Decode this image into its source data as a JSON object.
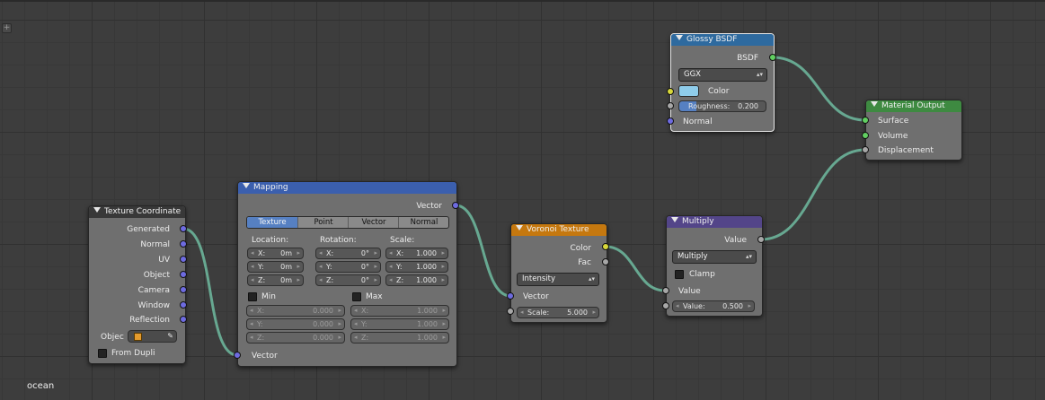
{
  "editor_label": "ocean",
  "corner_icon": "+",
  "colors": {
    "header_coord": "#383838",
    "header_mapping": "#3b5fae",
    "header_voronoi": "#c5780f",
    "header_multiply": "#534589",
    "header_glossy": "#2e6a9f",
    "header_output": "#3e8a41",
    "link": "#67a891"
  },
  "texture_coordinate": {
    "title": "Texture Coordinate",
    "outputs": [
      "Generated",
      "Normal",
      "UV",
      "Object",
      "Camera",
      "Window",
      "Reflection"
    ],
    "object_label": "Objec",
    "from_dupli": "From Dupli"
  },
  "mapping": {
    "title": "Mapping",
    "output": "Vector",
    "tabs": [
      "Texture",
      "Point",
      "Vector",
      "Normal"
    ],
    "active_tab": "Texture",
    "location_label": "Location:",
    "rotation_label": "Rotation:",
    "scale_label": "Scale:",
    "location": [
      {
        "axis": "X:",
        "value": "0m"
      },
      {
        "axis": "Y:",
        "value": "0m"
      },
      {
        "axis": "Z:",
        "value": "0m"
      }
    ],
    "rotation": [
      {
        "axis": "X:",
        "value": "0°"
      },
      {
        "axis": "Y:",
        "value": "0°"
      },
      {
        "axis": "Z:",
        "value": "0°"
      }
    ],
    "scale": [
      {
        "axis": "X:",
        "value": "1.000"
      },
      {
        "axis": "Y:",
        "value": "1.000"
      },
      {
        "axis": "Z:",
        "value": "1.000"
      }
    ],
    "min_label": "Min",
    "max_label": "Max",
    "min": [
      {
        "axis": "X:",
        "value": "0.000"
      },
      {
        "axis": "Y:",
        "value": "0.000"
      },
      {
        "axis": "Z:",
        "value": "0.000"
      }
    ],
    "max": [
      {
        "axis": "X:",
        "value": "1.000"
      },
      {
        "axis": "Y:",
        "value": "1.000"
      },
      {
        "axis": "Z:",
        "value": "1.000"
      }
    ],
    "input": "Vector"
  },
  "voronoi": {
    "title": "Voronoi Texture",
    "outputs": [
      "Color",
      "Fac"
    ],
    "coloring": "Intensity",
    "input_vector": "Vector",
    "scale_label": "Scale:",
    "scale_value": "5.000"
  },
  "multiply": {
    "title": "Multiply",
    "output": "Value",
    "operation": "Multiply",
    "clamp": "Clamp",
    "input_value": "Value",
    "value_label": "Value:",
    "value_value": "0.500"
  },
  "glossy": {
    "title": "Glossy BSDF",
    "output": "BSDF",
    "distribution": "GGX",
    "color_label": "Color",
    "roughness_label": "Roughness:",
    "roughness_value": "0.200",
    "roughness_level": 0.2,
    "normal_label": "Normal"
  },
  "material_output": {
    "title": "Material Output",
    "inputs": [
      "Surface",
      "Volume",
      "Displacement"
    ]
  }
}
